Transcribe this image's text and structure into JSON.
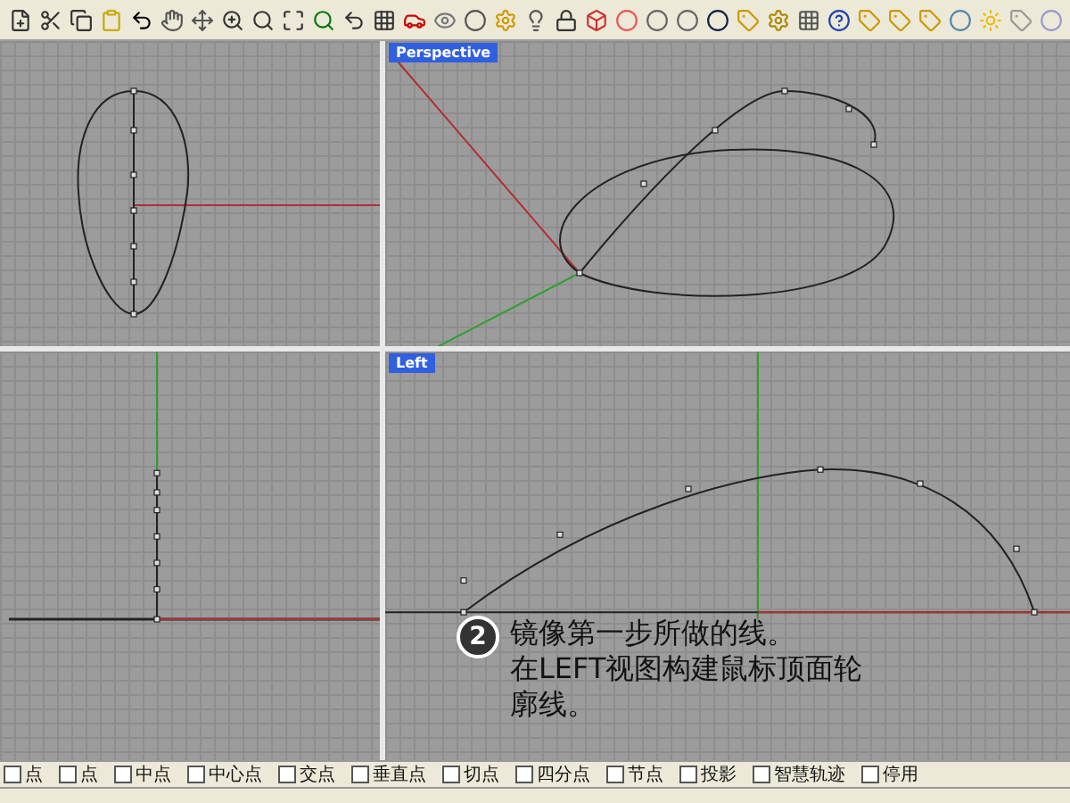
{
  "viewports": [
    {
      "kind": "top"
    },
    {
      "kind": "perspective",
      "label": "Perspective"
    },
    {
      "kind": "front"
    },
    {
      "kind": "left",
      "label": "Left"
    }
  ],
  "callout": {
    "number": "2",
    "lines": [
      "镜像第一步所做的线。",
      "在LEFT视图构建鼠标顶面轮廓线。"
    ]
  },
  "osnap": [
    {
      "label": "点",
      "checked": false
    },
    {
      "label": "点",
      "checked": false
    },
    {
      "label": "中点",
      "checked": false
    },
    {
      "label": "中心点",
      "checked": false
    },
    {
      "label": "交点",
      "checked": false
    },
    {
      "label": "垂直点",
      "checked": false
    },
    {
      "label": "切点",
      "checked": false
    },
    {
      "label": "四分点",
      "checked": false
    },
    {
      "label": "节点",
      "checked": false
    },
    {
      "label": "投影",
      "checked": false
    },
    {
      "label": "智慧轨迹",
      "checked": false
    },
    {
      "label": "停用",
      "checked": false
    }
  ]
}
